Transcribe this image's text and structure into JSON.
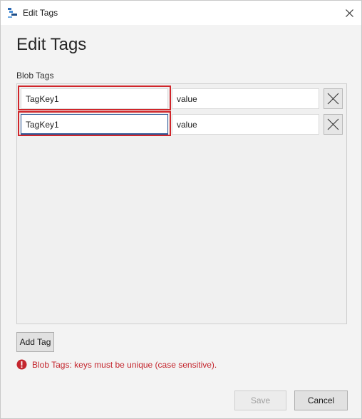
{
  "window": {
    "title": "Edit Tags"
  },
  "dialog": {
    "heading": "Edit Tags",
    "section_label": "Blob Tags"
  },
  "tags": [
    {
      "key": "TagKey1",
      "value": "value"
    },
    {
      "key": "TagKey1",
      "value": "value"
    }
  ],
  "buttons": {
    "add_tag": "Add Tag",
    "save": "Save",
    "cancel": "Cancel"
  },
  "error": {
    "message": "Blob Tags: keys must be unique (case sensitive)."
  },
  "icons": {
    "app": "storage-explorer-icon",
    "close": "close-icon",
    "delete": "delete-x-icon",
    "error": "error-icon"
  },
  "colors": {
    "error": "#c4262e",
    "focus": "#2b5797",
    "window_bg": "#f3f3f3"
  }
}
